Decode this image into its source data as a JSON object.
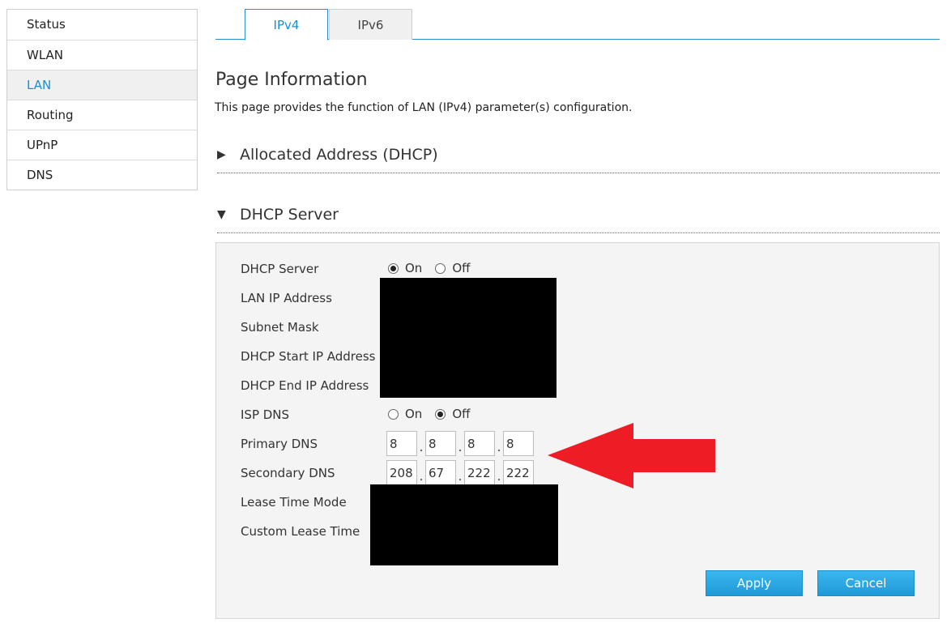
{
  "sidebar": {
    "items": [
      {
        "label": "Status"
      },
      {
        "label": "WLAN"
      },
      {
        "label": "LAN",
        "active": true
      },
      {
        "label": "Routing"
      },
      {
        "label": "UPnP"
      },
      {
        "label": "DNS"
      }
    ]
  },
  "tabs": [
    {
      "label": "IPv4",
      "active": true
    },
    {
      "label": "IPv6",
      "active": false
    }
  ],
  "page": {
    "title": "Page Information",
    "description": "This page provides the function of LAN (IPv4) parameter(s) configuration."
  },
  "sections": {
    "allocated": {
      "arrow": "▶",
      "title": "Allocated Address (DHCP)"
    },
    "dhcp": {
      "arrow": "▼",
      "title": "DHCP Server"
    }
  },
  "form": {
    "dhcp_server": {
      "label": "DHCP Server",
      "on_label": "On",
      "off_label": "Off",
      "selected": "On"
    },
    "lan_ip": {
      "label": "LAN IP Address"
    },
    "subnet_mask": {
      "label": "Subnet Mask"
    },
    "dhcp_start": {
      "label": "DHCP Start IP Address"
    },
    "dhcp_end": {
      "label": "DHCP End IP Address"
    },
    "isp_dns": {
      "label": "ISP DNS",
      "on_label": "On",
      "off_label": "Off",
      "selected": "Off"
    },
    "primary_dns": {
      "label": "Primary DNS",
      "octets": [
        "8",
        "8",
        "8",
        "8"
      ]
    },
    "secondary_dns": {
      "label": "Secondary DNS",
      "octets": [
        "208",
        "67",
        "222",
        "222"
      ]
    },
    "lease_mode": {
      "label": "Lease Time Mode"
    },
    "custom_lease": {
      "label": "Custom Lease Time"
    }
  },
  "buttons": {
    "apply": "Apply",
    "cancel": "Cancel"
  },
  "ip_separator": ".",
  "annotation": {
    "arrow_color": "#ee1c25"
  },
  "colors": {
    "accent": "#1e8ec9",
    "button": "#2aa6e2"
  }
}
